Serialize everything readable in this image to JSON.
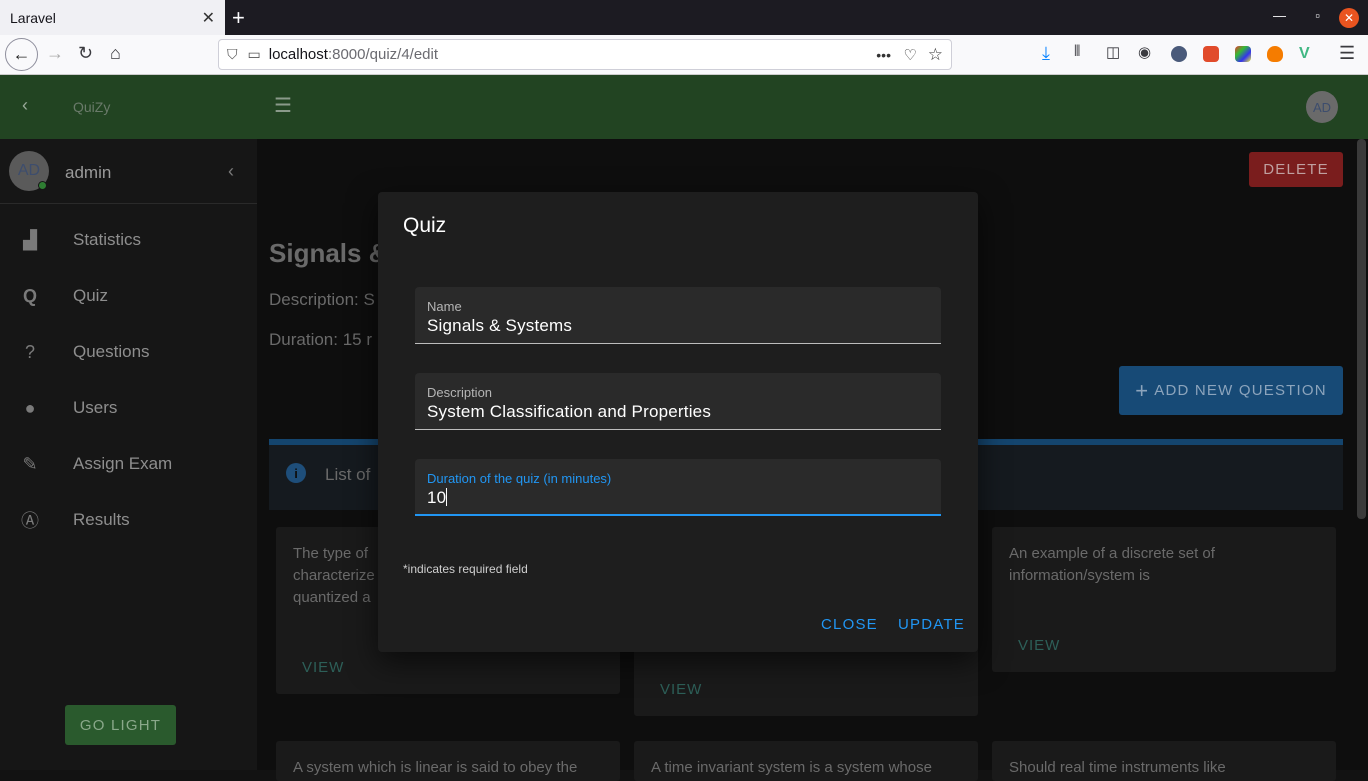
{
  "browser": {
    "tab_title": "Laravel",
    "tab_close": "✕",
    "new_tab": "+",
    "url_host": "localhost",
    "url_path": ":8000/quiz/4/edit",
    "more_dots": "•••"
  },
  "appbar": {
    "brand": "QuiZy",
    "avatar": "AD"
  },
  "sidebar": {
    "user_avatar": "AD",
    "user_name": "admin",
    "items": [
      {
        "label": "Statistics",
        "icon": "bar-chart-icon"
      },
      {
        "label": "Quiz",
        "icon": "quiz-q-icon"
      },
      {
        "label": "Questions",
        "icon": "question-head-icon"
      },
      {
        "label": "Users",
        "icon": "user-icon"
      },
      {
        "label": "Assign Exam",
        "icon": "assign-edit-icon"
      },
      {
        "label": "Results",
        "icon": "results-badge-icon"
      }
    ],
    "theme_button": "GO LIGHT"
  },
  "main": {
    "delete_button": "DELETE",
    "quiz_title_partial": "Signals &",
    "description_partial": "Description: S",
    "duration_partial": "Duration: 15 r",
    "add_question_button": "ADD NEW QUESTION",
    "info_text_partial": "List of",
    "cards": [
      {
        "text": "The type of characterize quantized a",
        "view": "VIEW"
      },
      {
        "text": "",
        "view": "VIEW"
      },
      {
        "text": "An example of a discrete set of information/system is",
        "view": "VIEW"
      },
      {
        "text": "A system which is linear is said to obey the",
        "view": ""
      },
      {
        "text": "A time invariant system is a system whose",
        "view": ""
      },
      {
        "text": "Should real time instruments like",
        "view": ""
      }
    ]
  },
  "dialog": {
    "title": "Quiz",
    "fields": [
      {
        "label": "Name",
        "value": "Signals & Systems"
      },
      {
        "label": "Description",
        "value": "System Classification and Properties"
      },
      {
        "label": "Duration of the quiz (in minutes)",
        "value": "10"
      }
    ],
    "required_note": "*indicates required field",
    "close_button": "CLOSE",
    "update_button": "UPDATE"
  },
  "colors": {
    "accent": "#2196f3",
    "appbar_green": "#388e3c",
    "delete_red": "#c62828",
    "add_blue": "#1976d2"
  }
}
